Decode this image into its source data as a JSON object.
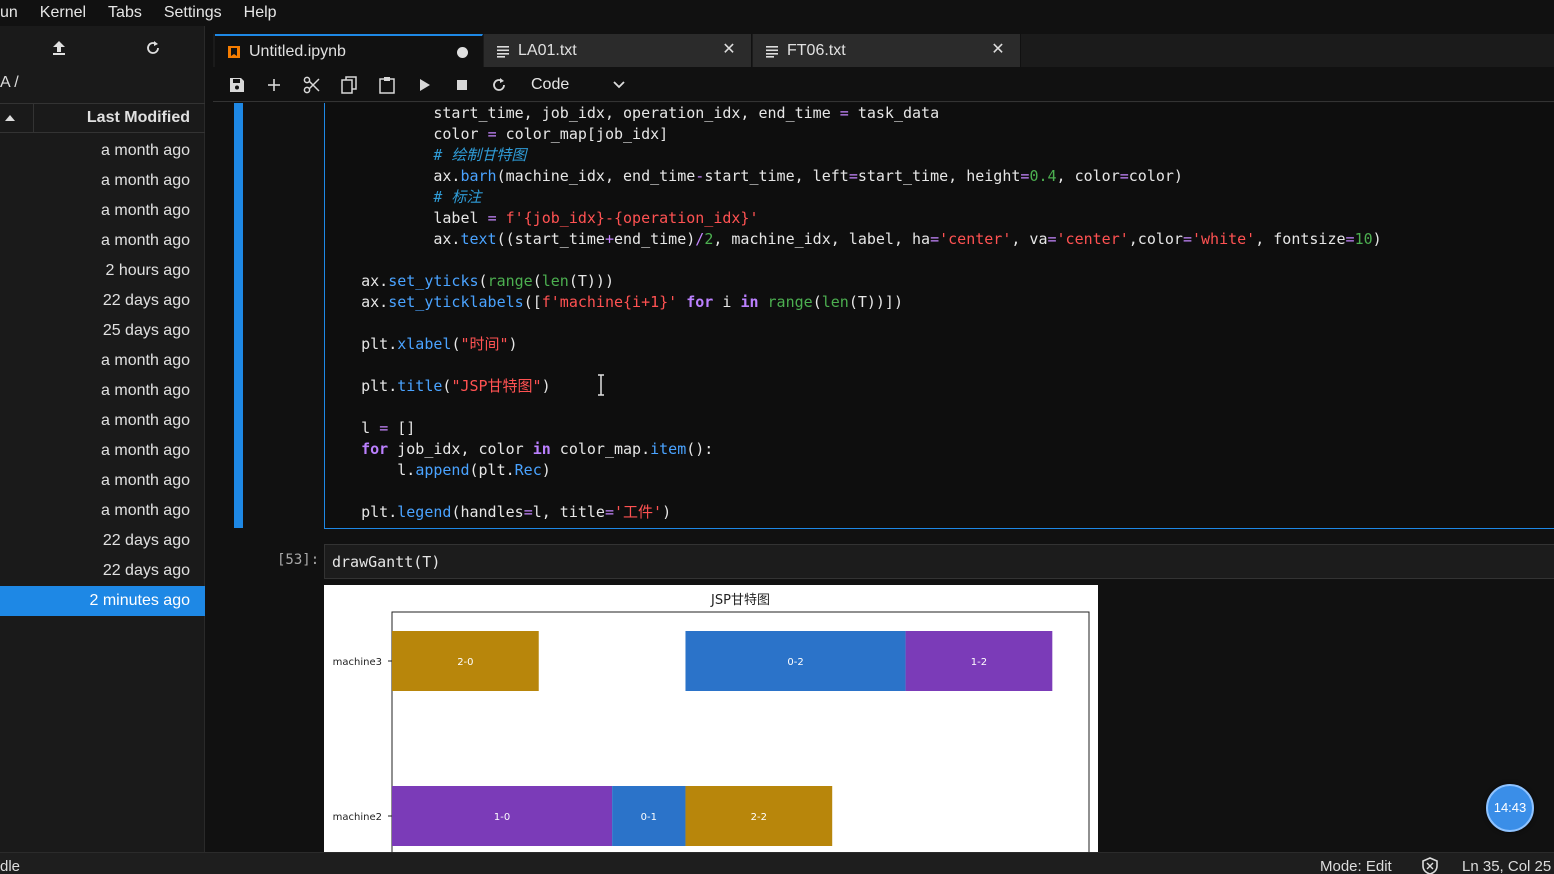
{
  "menubar": {
    "items": [
      "un",
      "Kernel",
      "Tabs",
      "Settings",
      "Help"
    ]
  },
  "filebrowser": {
    "path": "A /",
    "column_header": "Last Modified",
    "rows": [
      "a month ago",
      "a month ago",
      "a month ago",
      "a month ago",
      "2 hours ago",
      "22 days ago",
      "25 days ago",
      "a month ago",
      "a month ago",
      "a month ago",
      "a month ago",
      "a month ago",
      "a month ago",
      "22 days ago",
      "22 days ago",
      "2 minutes ago"
    ],
    "selected_index": 15
  },
  "tabs": [
    {
      "label": "Untitled.ipynb",
      "active": true,
      "unsaved": true,
      "icon": "notebook-icon"
    },
    {
      "label": "LA01.txt",
      "active": false,
      "icon": "text-file-icon"
    },
    {
      "label": "FT06.txt",
      "active": false,
      "icon": "text-file-icon"
    }
  ],
  "toolbar": {
    "cell_type": "Code"
  },
  "code_cell": {
    "lines": [
      "            start_time, job_idx, operation_idx, end_time = task_data",
      "            color = color_map[job_idx]",
      "            # 绘制甘特图",
      "            ax.barh(machine_idx, end_time-start_time, left=start_time, height=0.4, color=color)",
      "            # 标注",
      "            label = f'{job_idx}-{operation_idx}'",
      "            ax.text((start_time+end_time)/2, machine_idx, label, ha='center', va='center',color='white', fontsize=10)",
      "",
      "    ax.set_yticks(range(len(T)))",
      "    ax.set_yticklabels([f'machine{i+1}' for i in range(len(T))])",
      "",
      "    plt.xlabel(\"时间\")",
      "",
      "    plt.title(\"JSP甘特图\")",
      "",
      "    l = []",
      "    for job_idx, color in color_map.item():",
      "        l.append(plt.Rec)",
      "",
      "    plt.legend(handles=l, title='工件')"
    ]
  },
  "cell2": {
    "prompt": "[53]:",
    "code": "drawGantt(T)"
  },
  "chart_data": {
    "type": "bar",
    "title": "JSP甘特图",
    "orientation": "horizontal-gantt",
    "rows": [
      {
        "label": "machine3",
        "tasks": [
          {
            "label": "2-0",
            "start": 0,
            "end": 4,
            "color": "#b8860b"
          },
          {
            "label": "0-2",
            "start": 8,
            "end": 14,
            "color": "#2b73c9"
          },
          {
            "label": "1-2",
            "start": 14,
            "end": 18,
            "color": "#7b3bb8"
          }
        ]
      },
      {
        "label": "machine2",
        "tasks": [
          {
            "label": "1-0",
            "start": 0,
            "end": 6,
            "color": "#7b3bb8"
          },
          {
            "label": "0-1",
            "start": 6,
            "end": 8,
            "color": "#2b73c9"
          },
          {
            "label": "2-2",
            "start": 8,
            "end": 12,
            "color": "#b8860b"
          }
        ]
      }
    ],
    "xlim": [
      0,
      19
    ]
  },
  "clock": {
    "time": "14:43"
  },
  "status": {
    "left": "dle",
    "mode": "Mode: Edit",
    "position": "Ln 35, Col 25"
  },
  "colors": {
    "accent": "#1e88e5",
    "background": "#111111"
  }
}
